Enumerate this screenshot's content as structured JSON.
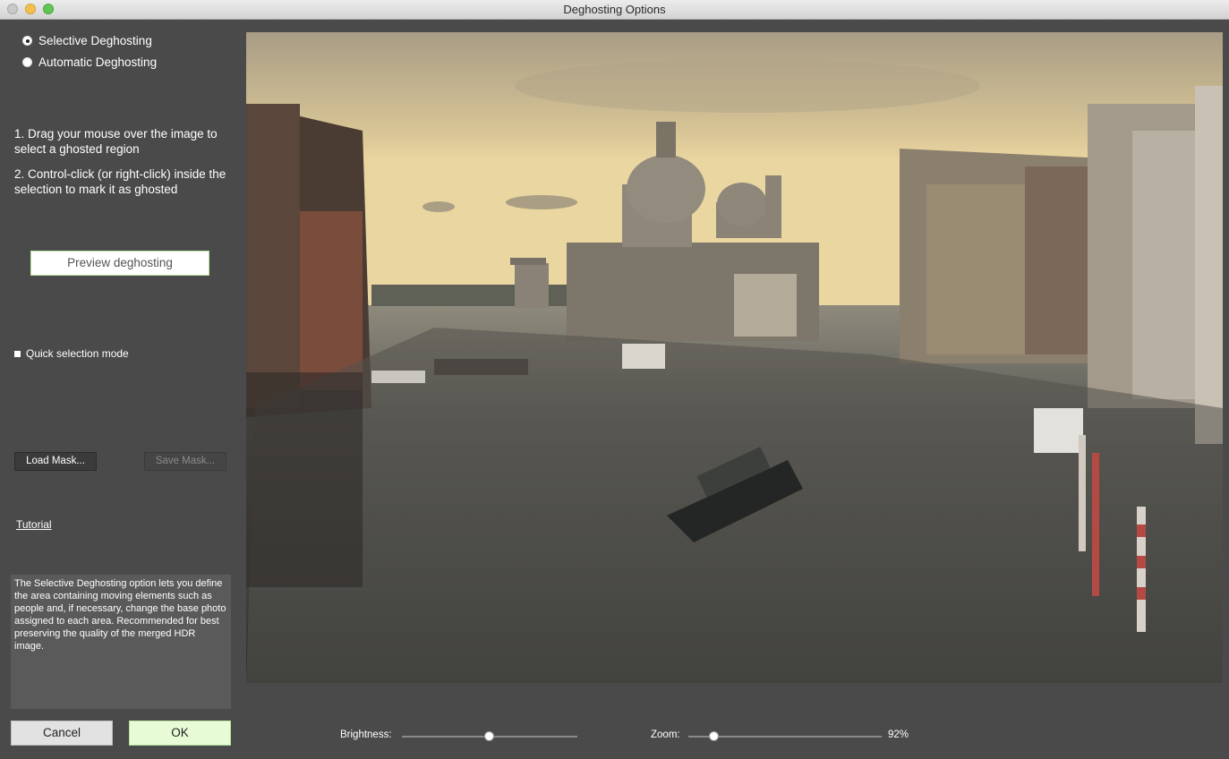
{
  "window": {
    "title": "Deghosting Options"
  },
  "mode": {
    "options": [
      {
        "label": "Selective Deghosting",
        "selected": true
      },
      {
        "label": "Automatic Deghosting",
        "selected": false
      }
    ]
  },
  "instructions": {
    "step1": "1. Drag your mouse over the image to select a ghosted region",
    "step2": "2. Control-click (or right-click) inside the selection to mark it as ghosted"
  },
  "preview_button": "Preview deghosting",
  "quick_selection": {
    "label": "Quick selection mode",
    "checked": false
  },
  "mask": {
    "load_label": "Load Mask...",
    "save_label": "Save Mask...",
    "save_enabled": false
  },
  "tutorial_link": "Tutorial",
  "description": "The Selective Deghosting option lets you define the area containing moving elements such as people and, if necessary, change the base photo assigned to each area. Recommended for best preserving the quality of the merged HDR image.",
  "actions": {
    "cancel_label": "Cancel",
    "ok_label": "OK"
  },
  "controls": {
    "brightness": {
      "label": "Brightness:",
      "value": 0.5
    },
    "zoom": {
      "label": "Zoom:",
      "value": 0.15,
      "display": "92%"
    }
  },
  "colors": {
    "accent_green": "#b8e29f",
    "ok_bg": "#e6fbd6",
    "panel_bg": "#4a4a4a"
  }
}
